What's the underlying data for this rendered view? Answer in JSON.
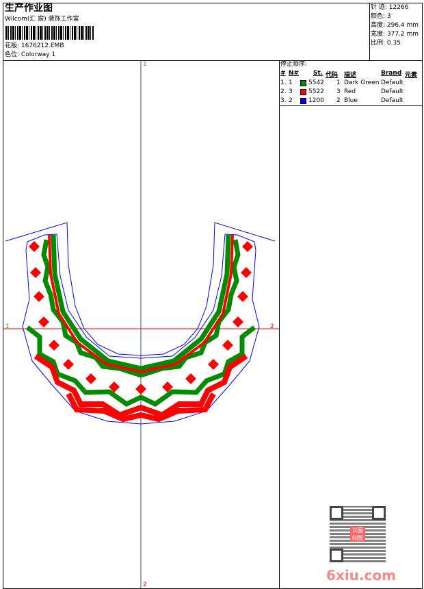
{
  "header": {
    "title": "生产作业图",
    "company": "Wilcom(汇 宸) 装饰工作室",
    "design_label": "花版:",
    "design_value": "1676212.EMB",
    "colorway_label": "色位:",
    "colorway_value": "Colorway 1"
  },
  "info": {
    "stitches": "针 迹: 12266",
    "colors": "颜色: 3",
    "height": "高度: 296.4 mm",
    "width": "宽度: 377.2 mm",
    "scale": "比例: 0.35"
  },
  "stop_sequence": {
    "title": "停止顺序:",
    "columns": [
      "#",
      "N#",
      "St.",
      "代码",
      "描述",
      "Brand",
      "元素"
    ],
    "rows": [
      {
        "idx": "1.",
        "n": "1",
        "color": "#008c00",
        "st": "5542",
        "code": "1",
        "desc": "Dark Green",
        "brand": "Default"
      },
      {
        "idx": "2.",
        "n": "3",
        "color": "#ff0000",
        "st": "5522",
        "code": "3",
        "desc": "Red",
        "brand": "Default"
      },
      {
        "idx": "3.",
        "n": "2",
        "color": "#0000ff",
        "st": "1200",
        "code": "2",
        "desc": "Blue",
        "brand": "Default"
      }
    ]
  },
  "axes": {
    "top": "1",
    "bottom": "2",
    "left": "1",
    "right": "2"
  },
  "watermark": {
    "text": "6xiu.com",
    "seal": "以图制版"
  }
}
